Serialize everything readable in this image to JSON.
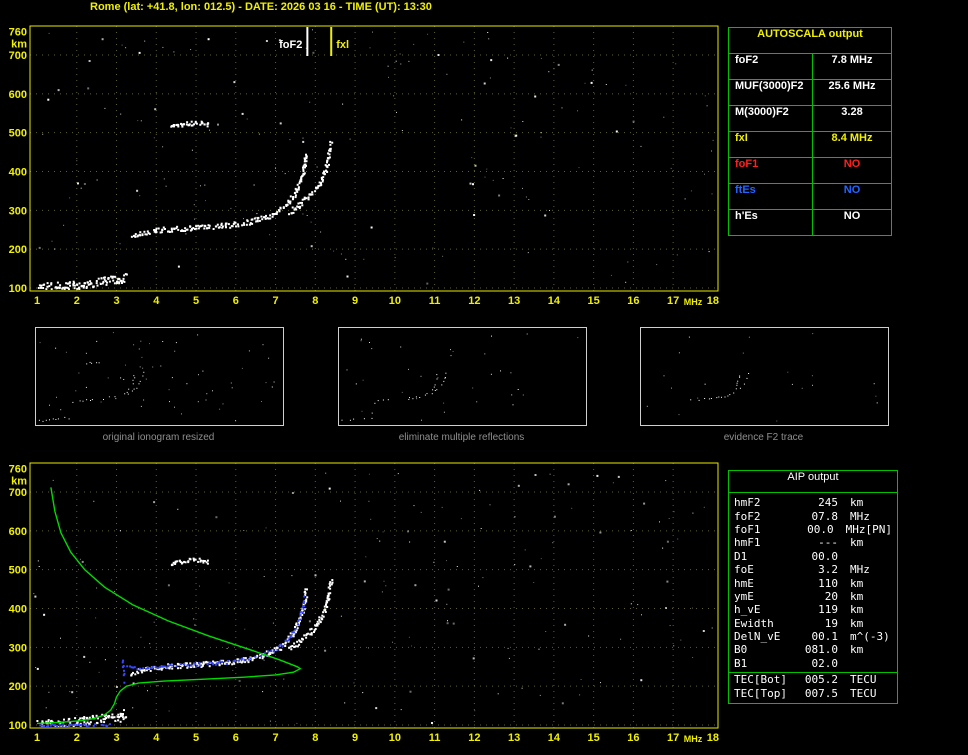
{
  "window": {
    "title": "Rome (lat: +41.8, lon: 012.5) - DATE: 2026 03 16 - TIME (UT): 13:30"
  },
  "colors": {
    "accent_yellow": "#f0f000",
    "table_green": "#00c000",
    "profile_green": "#00dc00",
    "restored_blue": "#3848ff",
    "status_red": "#ff2020",
    "status_blue": "#2266ff",
    "caption_gray": "#8f8f8f"
  },
  "autoscala_table": {
    "header": "AUTOSCALA output",
    "rows": [
      {
        "label": "foF2",
        "value": "7.8 MHz",
        "color": "#ffffff"
      },
      {
        "label": "MUF(3000)F2",
        "value": "25.6 MHz",
        "color": "#ffffff"
      },
      {
        "label": "M(3000)F2",
        "value": "3.28",
        "color": "#ffffff"
      },
      {
        "label": "fxI",
        "value": "8.4 MHz",
        "color": "#f0f000"
      },
      {
        "label": "foF1",
        "value": "NO",
        "color": "#ff2020"
      },
      {
        "label": "ftEs",
        "value": "NO",
        "color": "#2266ff"
      },
      {
        "label": "h'Es",
        "value": "NO",
        "color": "#ffffff"
      }
    ]
  },
  "thumbnails": [
    {
      "caption": "original ionogram resized"
    },
    {
      "caption": "eliminate multiple reflections"
    },
    {
      "caption": "evidence F2 trace"
    }
  ],
  "aip_table": {
    "header": "AIP output",
    "rows": [
      {
        "label": "hmF2",
        "value": "245",
        "unit": "km"
      },
      {
        "label": "foF2",
        "value": "07.8",
        "unit": "MHz"
      },
      {
        "label": "foF1",
        "value": "00.0",
        "unit": "MHz",
        "extra": "[PN]"
      },
      {
        "label": "hmF1",
        "value": "---",
        "unit": "km"
      },
      {
        "label": "D1",
        "value": "00.0",
        "unit": ""
      },
      {
        "label": "foE",
        "value": "3.2",
        "unit": "MHz"
      },
      {
        "label": "hmE",
        "value": "110",
        "unit": "km"
      },
      {
        "label": "ymE",
        "value": "20",
        "unit": "km"
      },
      {
        "label": "h_vE",
        "value": "119",
        "unit": "km"
      },
      {
        "label": "Ewidth",
        "value": "19",
        "unit": "km"
      },
      {
        "label": "DelN_vE",
        "value": "00.1",
        "unit": "m^(-3)"
      },
      {
        "label": "B0",
        "value": "081.0",
        "unit": "km"
      },
      {
        "label": "B1",
        "value": "02.0",
        "unit": ""
      },
      {
        "label": "TEC[Bot]",
        "value": "005.2",
        "unit": "TECU",
        "sep_above": true
      },
      {
        "label": "TEC[Top]",
        "value": "007.5",
        "unit": "TECU"
      }
    ]
  },
  "chart_data": [
    {
      "id": "main-ionogram",
      "type": "scatter",
      "title": "",
      "xlabel": "MHz",
      "ylabel": "km",
      "xlim": [
        1,
        18
      ],
      "ylim": [
        90,
        775
      ],
      "xticks": [
        1,
        2,
        3,
        4,
        5,
        6,
        7,
        8,
        9,
        10,
        11,
        12,
        13,
        14,
        15,
        16,
        17,
        18
      ],
      "yticks": [
        100,
        200,
        300,
        400,
        500,
        600,
        700,
        760
      ],
      "grid": true,
      "markers": [
        {
          "name": "foF2",
          "label": "foF2",
          "freq_mhz": 7.8,
          "color": "#ffffff"
        },
        {
          "name": "fxI",
          "label": "fxl",
          "freq_mhz": 8.4,
          "color": "#f0f000"
        }
      ],
      "traces": {
        "e_region": [
          [
            1.0,
            103
          ],
          [
            1.5,
            105
          ],
          [
            2.0,
            110
          ],
          [
            2.4,
            116
          ],
          [
            2.8,
            121
          ],
          [
            3.05,
            122
          ],
          [
            3.25,
            133
          ]
        ],
        "f_ordinary": [
          [
            3.35,
            232
          ],
          [
            3.6,
            243
          ],
          [
            3.9,
            249
          ],
          [
            4.3,
            253
          ],
          [
            4.8,
            256
          ],
          [
            5.3,
            259
          ],
          [
            5.8,
            264
          ],
          [
            6.3,
            271
          ],
          [
            6.7,
            282
          ],
          [
            7.0,
            296
          ],
          [
            7.25,
            315
          ],
          [
            7.45,
            342
          ],
          [
            7.6,
            375
          ],
          [
            7.7,
            412
          ],
          [
            7.76,
            452
          ]
        ],
        "f_extraordinary": [
          [
            7.35,
            298
          ],
          [
            7.6,
            318
          ],
          [
            7.85,
            340
          ],
          [
            8.05,
            365
          ],
          [
            8.2,
            392
          ],
          [
            8.3,
            425
          ],
          [
            8.38,
            478
          ]
        ],
        "second_hop": [
          [
            4.35,
            516
          ],
          [
            4.7,
            525
          ],
          [
            5.0,
            527
          ],
          [
            5.35,
            522
          ]
        ]
      }
    },
    {
      "id": "bottom-ionogram-with-profile",
      "type": "scatter",
      "title": "",
      "xlabel": "MHz",
      "ylabel": "km",
      "xlim": [
        1,
        18
      ],
      "ylim": [
        90,
        775
      ],
      "xticks": [
        1,
        2,
        3,
        4,
        5,
        6,
        7,
        8,
        9,
        10,
        11,
        12,
        13,
        14,
        15,
        16,
        17,
        18
      ],
      "yticks": [
        100,
        200,
        300,
        400,
        500,
        600,
        700,
        760
      ],
      "grid": true,
      "traces": {
        "e_region": [
          [
            1.0,
            103
          ],
          [
            1.5,
            105
          ],
          [
            2.0,
            110
          ],
          [
            2.4,
            116
          ],
          [
            2.8,
            121
          ],
          [
            3.05,
            122
          ],
          [
            3.25,
            133
          ]
        ],
        "f_ordinary": [
          [
            3.35,
            232
          ],
          [
            3.6,
            243
          ],
          [
            3.9,
            249
          ],
          [
            4.3,
            253
          ],
          [
            4.8,
            256
          ],
          [
            5.3,
            259
          ],
          [
            5.8,
            264
          ],
          [
            6.3,
            271
          ],
          [
            6.7,
            282
          ],
          [
            7.0,
            296
          ],
          [
            7.25,
            315
          ],
          [
            7.45,
            342
          ],
          [
            7.6,
            375
          ],
          [
            7.7,
            412
          ],
          [
            7.76,
            452
          ]
        ],
        "f_extraordinary": [
          [
            7.35,
            298
          ],
          [
            7.6,
            318
          ],
          [
            7.85,
            340
          ],
          [
            8.05,
            365
          ],
          [
            8.2,
            392
          ],
          [
            8.3,
            425
          ],
          [
            8.38,
            478
          ]
        ],
        "second_hop": [
          [
            4.35,
            516
          ],
          [
            4.7,
            525
          ],
          [
            5.0,
            527
          ],
          [
            5.35,
            522
          ]
        ]
      },
      "restored_trace_color": "#3848ff",
      "restored_trace": {
        "vertical": [
          [
            3.12,
            268
          ],
          [
            3.16,
            240
          ],
          [
            3.2,
            210
          ]
        ],
        "f_trace": [
          [
            3.2,
            252
          ],
          [
            3.6,
            249
          ],
          [
            4.2,
            253
          ],
          [
            5.0,
            258
          ],
          [
            5.8,
            264
          ],
          [
            6.5,
            276
          ],
          [
            7.0,
            296
          ],
          [
            7.35,
            330
          ],
          [
            7.55,
            365
          ],
          [
            7.68,
            405
          ],
          [
            7.74,
            445
          ]
        ],
        "e_trace": [
          [
            1.0,
            101
          ],
          [
            1.6,
            101
          ],
          [
            2.3,
            102
          ],
          [
            2.95,
            104
          ]
        ]
      },
      "profile_color": "#00dc00",
      "density_profile": [
        [
          1.35,
          712
        ],
        [
          1.45,
          650
        ],
        [
          1.6,
          595
        ],
        [
          1.85,
          545
        ],
        [
          2.2,
          500
        ],
        [
          2.7,
          455
        ],
        [
          3.4,
          410
        ],
        [
          4.3,
          368
        ],
        [
          5.3,
          330
        ],
        [
          6.3,
          296
        ],
        [
          7.1,
          268
        ],
        [
          7.55,
          250
        ],
        [
          7.62,
          245
        ],
        [
          7.45,
          236
        ],
        [
          7.0,
          229
        ],
        [
          6.2,
          223
        ],
        [
          5.2,
          218
        ],
        [
          4.2,
          213
        ],
        [
          3.55,
          208
        ],
        [
          3.25,
          200
        ],
        [
          3.1,
          188
        ],
        [
          3.0,
          172
        ],
        [
          2.95,
          155
        ],
        [
          2.85,
          138
        ],
        [
          2.7,
          126
        ],
        [
          2.45,
          117
        ],
        [
          2.1,
          111
        ],
        [
          1.6,
          107
        ],
        [
          1.0,
          104
        ]
      ]
    }
  ]
}
